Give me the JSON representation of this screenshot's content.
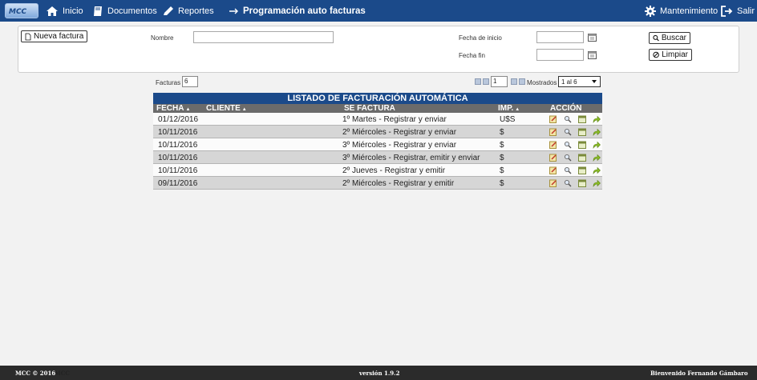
{
  "app": {
    "logo_text": "MCC"
  },
  "nav": {
    "home": "Inicio",
    "documents": "Documentos",
    "reports": "Reportes",
    "page_title": "Programación auto facturas",
    "maintenance": "Mantenimiento",
    "logout": "Salir"
  },
  "filters": {
    "new_invoice": "Nueva factura",
    "name_label": "Nombre",
    "name_value": "",
    "start_label": "Fecha de inicio",
    "start_value": "",
    "end_label": "Fecha fin",
    "end_value": "",
    "search": "Buscar",
    "clear": "Limpiar"
  },
  "pagination": {
    "count_label": "Facturas",
    "count": "6",
    "page": "1",
    "shown_label": "Mostrados",
    "shown_value": "1 al 6"
  },
  "table": {
    "title": "LISTADO DE FACTURACIÓN AUTOMÁTICA",
    "columns": {
      "date": "FECHA",
      "client": "CLIENTE",
      "type": "SE FACTURA",
      "amount": "IMP.",
      "action": "ACCIÓN"
    },
    "rows": [
      {
        "date": "01/12/2016",
        "client": "",
        "type": "1º Martes - Registrar y enviar",
        "amount": "U$S"
      },
      {
        "date": "10/11/2016",
        "client": "",
        "type": "2º Miércoles - Registrar y enviar",
        "amount": "$"
      },
      {
        "date": "10/11/2016",
        "client": "",
        "type": "3º Miércoles - Registrar y enviar",
        "amount": "$"
      },
      {
        "date": "10/11/2016",
        "client": "",
        "type": "3º Miércoles - Registrar, emitir y enviar",
        "amount": "$"
      },
      {
        "date": "10/11/2016",
        "client": "",
        "type": "2º Jueves - Registrar y emitir",
        "amount": "$"
      },
      {
        "date": "09/11/2016",
        "client": "",
        "type": "2º Miércoles - Registrar y emitir",
        "amount": "$"
      }
    ]
  },
  "footer": {
    "copyright": "MCC © 2016",
    "brand": "MCC",
    "version": "versión 1.9.2",
    "welcome": "Bienvenido Fernando Gámbaro"
  },
  "colors": {
    "brand_blue": "#1b4a8a",
    "header_gray": "#6b6b6b",
    "footer": "#2b2b2b"
  }
}
